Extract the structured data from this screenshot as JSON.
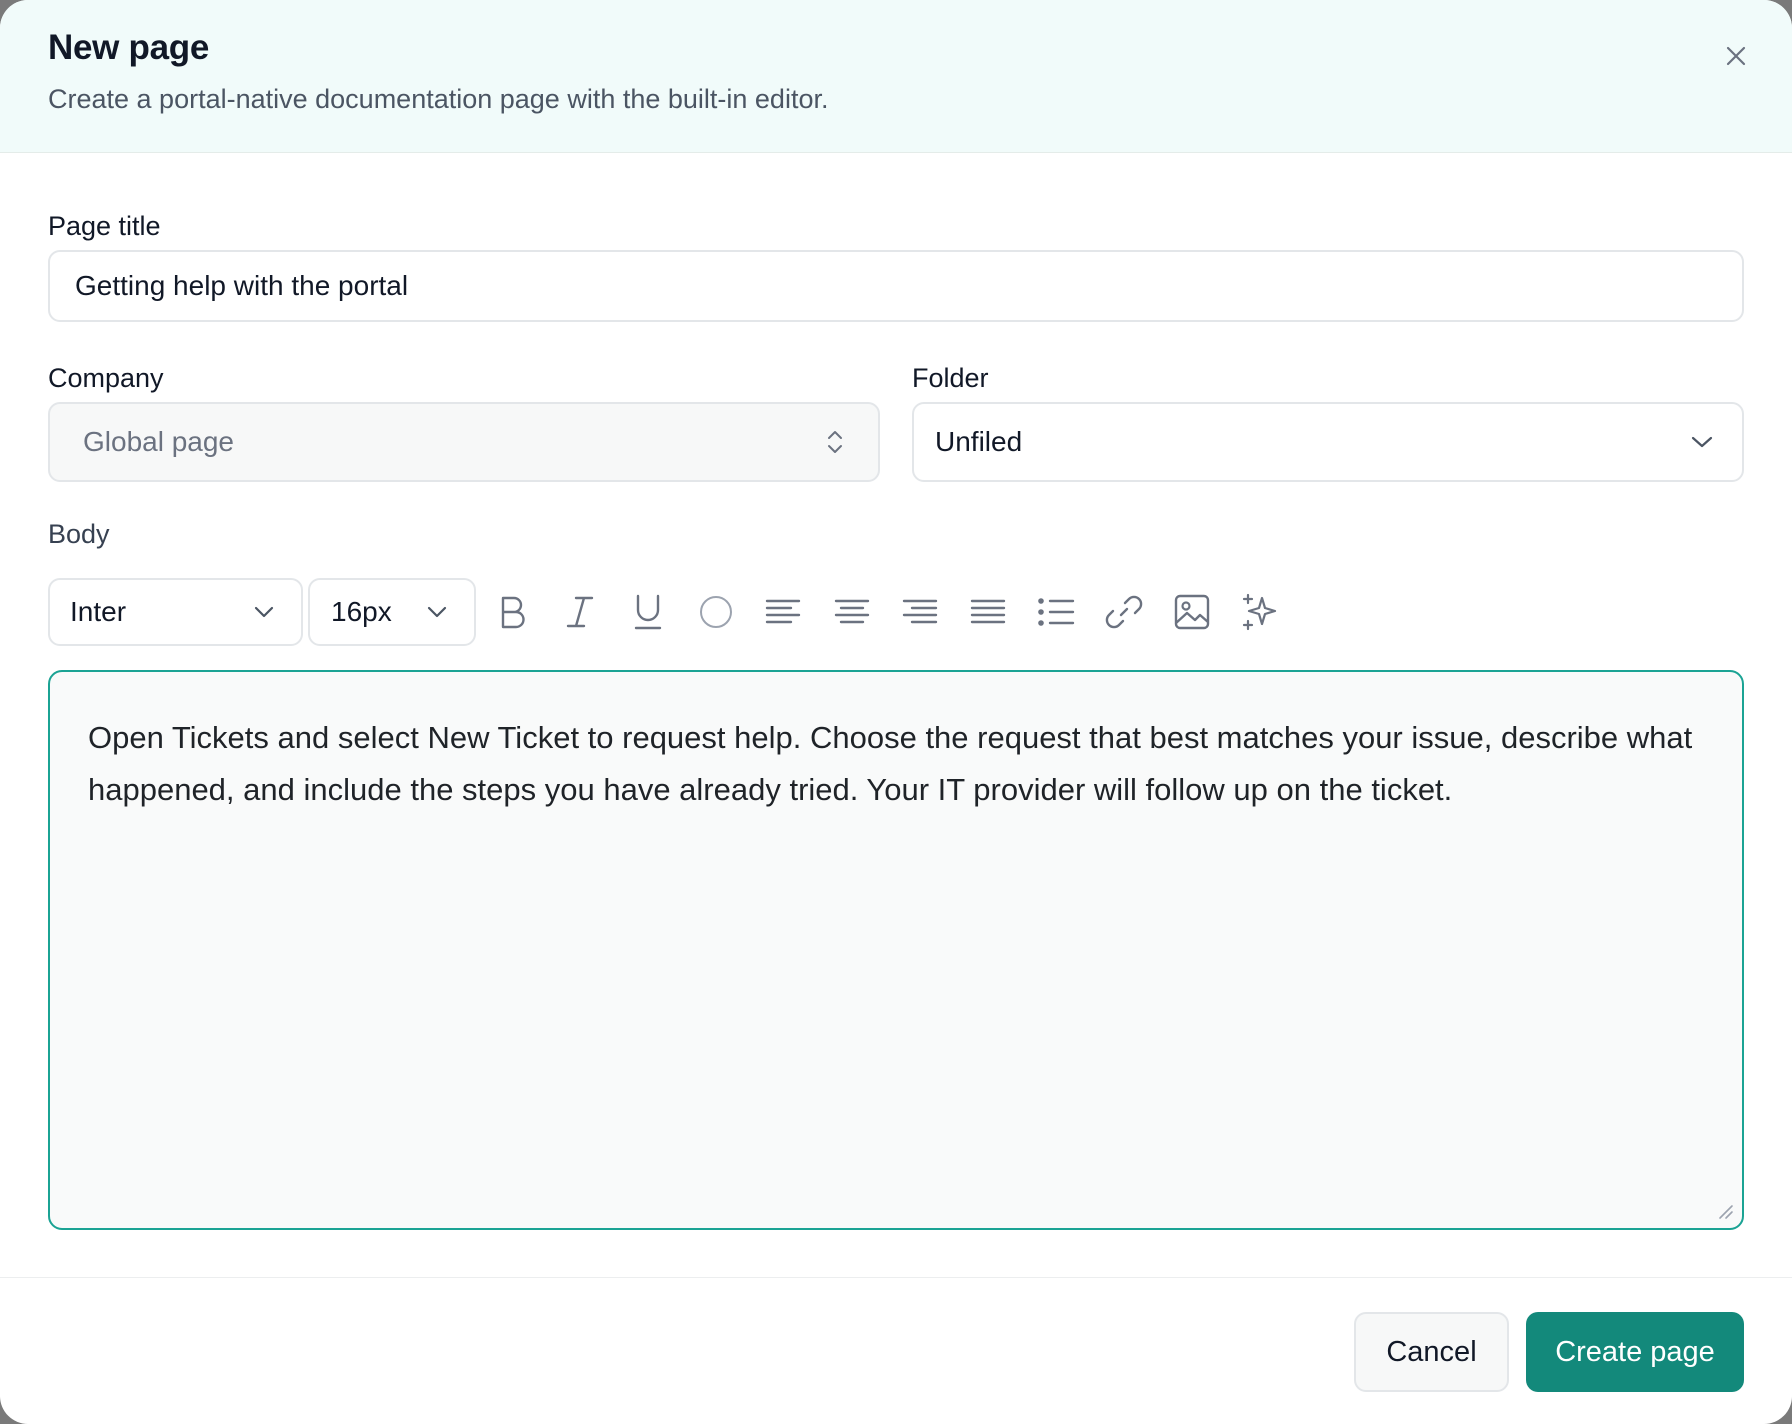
{
  "dialog": {
    "title": "New page",
    "subtitle": "Create a portal-native documentation page with the built-in editor."
  },
  "form": {
    "page_title_label": "Page title",
    "page_title_value": "Getting help with the portal",
    "company_label": "Company",
    "company_value": "Global page",
    "folder_label": "Folder",
    "folder_value": "Unfiled",
    "body_label": "Body"
  },
  "toolbar": {
    "font_family": "Inter",
    "font_size": "16px",
    "tools": [
      "bold-icon",
      "italic-icon",
      "underline-icon",
      "text-color-icon",
      "align-left-icon",
      "align-center-icon",
      "align-right-icon",
      "align-justify-icon",
      "bullet-list-icon",
      "link-icon",
      "image-icon",
      "ai-sparkle-icon"
    ]
  },
  "editor": {
    "body_text": "Open Tickets and select New Ticket to request help. Choose the request that best matches your issue, describe what happened, and include the steps you have already tried. Your IT provider will follow up on the ticket."
  },
  "footer": {
    "cancel_label": "Cancel",
    "create_label": "Create page"
  },
  "colors": {
    "accent": "#13897b",
    "editor_border": "#1ba394",
    "header_bg": "#f1fbfa"
  }
}
